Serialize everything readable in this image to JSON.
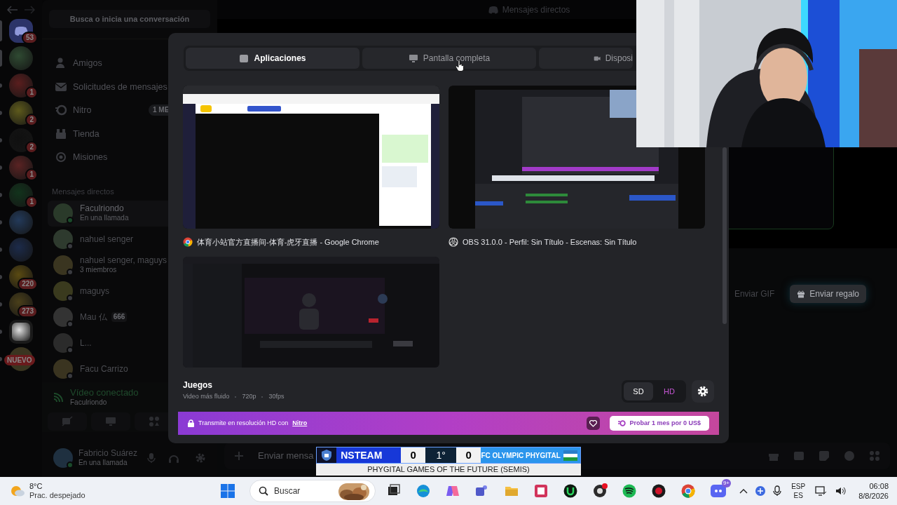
{
  "header": {
    "title": "Mensajes directos"
  },
  "servers": [
    {
      "badge": "53",
      "kind": "discord"
    },
    {
      "kind": "avatar"
    },
    {
      "badge": "1",
      "kind": "avatar"
    },
    {
      "badge": "2",
      "kind": "avatar"
    },
    {
      "badge": "2",
      "kind": "avatar"
    },
    {
      "badge": "1",
      "kind": "avatar"
    },
    {
      "badge": "1",
      "kind": "avatar"
    },
    {
      "kind": "avatar"
    },
    {
      "kind": "avatar"
    },
    {
      "badge": "220",
      "kind": "avatar"
    },
    {
      "badge": "273",
      "kind": "avatar"
    },
    {
      "kind": "avatar"
    },
    {
      "badge": "NUEVO",
      "kind": "new"
    }
  ],
  "sidebar": {
    "search_placeholder": "Busca o inicia una conversación",
    "nav": [
      {
        "label": "Amigos",
        "kind": "friends"
      },
      {
        "label": "Solicitudes de mensajes",
        "kind": "mail"
      },
      {
        "label": "Nitro",
        "kind": "nitro",
        "badge": "1 ME"
      },
      {
        "label": "Tienda",
        "kind": "shop"
      },
      {
        "label": "Misiones",
        "kind": "quests"
      }
    ],
    "dm_heading": "Mensajes directos",
    "dms": [
      {
        "name": "Faculriondo",
        "subtitle": "En una llamada",
        "selected": true
      },
      {
        "name": "nahuel senger",
        "selected": false
      },
      {
        "name": "nahuel senger, maguys",
        "subtitle": "3 miembros",
        "selected": false
      },
      {
        "name": "maguys",
        "selected": false
      },
      {
        "name": "Mau 仏",
        "tag": "666",
        "selected": false
      },
      {
        "name": "L...",
        "selected": false
      },
      {
        "name": "Facu Carrizo",
        "selected": false
      }
    ],
    "voice": {
      "status": "Vídeo conectado",
      "channel": "Faculriondo"
    },
    "user": {
      "name": "Fabricio Suárez",
      "status": "En una llamada"
    }
  },
  "composer": {
    "placeholder": "Enviar mensa"
  },
  "main": {
    "buttons": [
      {
        "label": "Enviar GIF",
        "kind": "plain"
      },
      {
        "label": "Enviar regalo",
        "kind": "gift"
      }
    ]
  },
  "dialog": {
    "tabs": [
      {
        "label": "Aplicaciones",
        "kind": "apps",
        "selected": true
      },
      {
        "label": "Pantalla completa",
        "kind": "screen",
        "selected": false
      },
      {
        "label": "Disposi",
        "kind": "camera",
        "selected": false
      }
    ],
    "sources": [
      {
        "title": "体育小站官方直播间-体育-虎牙直播 - Google Chrome",
        "kind": "chrome"
      },
      {
        "title": "OBS 31.0.0 - Perfil: Sin Título - Escenas: Sin Título",
        "kind": "obs"
      },
      {
        "kind": "discord"
      }
    ],
    "preset": {
      "title": "Juegos",
      "details": [
        "Video más fluido",
        "720p",
        "30fps"
      ]
    },
    "quality": [
      {
        "label": "SD",
        "selected": true
      },
      {
        "label": "HD",
        "selected": false
      }
    ],
    "banner": {
      "text": "Transmite en resolución HD con",
      "link": "Nitro",
      "button": "Probar 1 mes por 0 US$"
    }
  },
  "scoreboard": {
    "home": "NSTEAM",
    "home_score": "0",
    "period": "1°",
    "away_score": "0",
    "away": "FC OLYMPIC PHYGITAL",
    "caption": "PHYGITAL GAMES OF THE FUTURE (SEMIS)"
  },
  "taskbar": {
    "temperature": "8°C",
    "weather": "Prac. despejado",
    "search": "Buscar",
    "discord_badge": "9+",
    "language": "ESP",
    "layout": "ES",
    "time": "06:08",
    "date": "8/8/2026"
  }
}
